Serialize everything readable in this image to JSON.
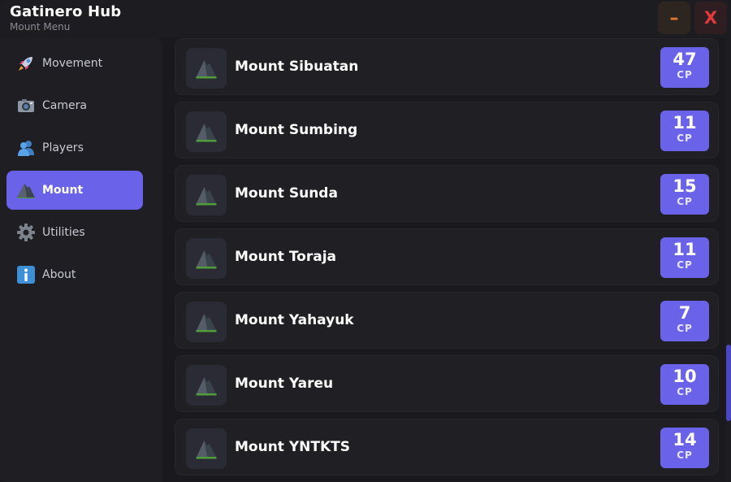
{
  "window": {
    "title": "Gatinero Hub",
    "subtitle": "Mount Menu",
    "minimize_label": "–",
    "close_label": "X"
  },
  "sidebar": {
    "items": [
      {
        "label": "Movement",
        "icon": "rocket-icon",
        "active": false
      },
      {
        "label": "Camera",
        "icon": "camera-icon",
        "active": false
      },
      {
        "label": "Players",
        "icon": "players-icon",
        "active": false
      },
      {
        "label": "Mount",
        "icon": "mountain-icon",
        "active": true
      },
      {
        "label": "Utilities",
        "icon": "gear-icon",
        "active": false
      },
      {
        "label": "About",
        "icon": "info-icon",
        "active": false
      }
    ]
  },
  "mounts": [
    {
      "name": "Mount Sibuatan",
      "cp": "47",
      "unit": "CP"
    },
    {
      "name": "Mount Sumbing",
      "cp": "11",
      "unit": "CP"
    },
    {
      "name": "Mount Sunda",
      "cp": "15",
      "unit": "CP"
    },
    {
      "name": "Mount Toraja",
      "cp": "11",
      "unit": "CP"
    },
    {
      "name": "Mount Yahayuk",
      "cp": "7",
      "unit": "CP"
    },
    {
      "name": "Mount Yareu",
      "cp": "10",
      "unit": "CP"
    },
    {
      "name": "Mount YNTKTS",
      "cp": "14",
      "unit": "CP"
    }
  ],
  "colors": {
    "accent": "#6a63ea",
    "background": "#1a1a1e",
    "card": "#1f1f24",
    "minimize": "#e07a2d",
    "close": "#e03a3a"
  }
}
